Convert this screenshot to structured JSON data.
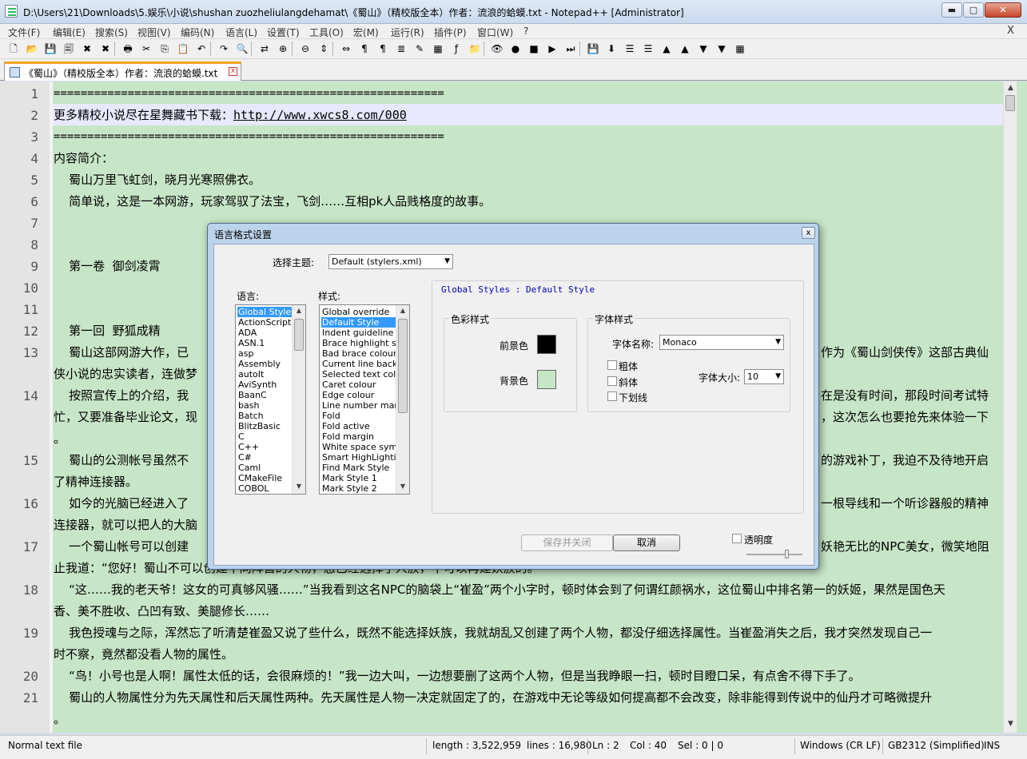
{
  "window": {
    "title": "D:\\Users\\21\\Downloads\\5.娱乐\\小说\\shushan zuozheliulangdehamat\\《蜀山》（精校版全本）作者：流浪的蛤蟆.txt - Notepad++ [Administrator]",
    "min_label": "▬",
    "max_label": "▢",
    "close_label": "✕"
  },
  "menu": {
    "items": [
      "文件(F)",
      "编辑(E)",
      "搜索(S)",
      "视图(V)",
      "编码(N)",
      "语言(L)",
      "设置(T)",
      "工具(O)",
      "宏(M)",
      "运行(R)",
      "插件(P)",
      "窗口(W)",
      "?"
    ],
    "close": "X"
  },
  "toolbar": {
    "icons": [
      "new-file-icon",
      "open-file-icon",
      "save-icon",
      "save-all-icon",
      "close-icon",
      "close-all-icon",
      "print-icon",
      "cut-icon",
      "copy-icon",
      "paste-icon",
      "undo-icon",
      "redo-icon",
      "find-icon",
      "replace-icon",
      "zoom-in-icon",
      "zoom-out-icon",
      "sync-vertical-icon",
      "sync-horizontal-icon",
      "word-wrap-icon",
      "show-all-chars-icon",
      "indent-guide-icon",
      "user-language-icon",
      "doc-map-icon",
      "function-list-icon",
      "folder-workspace-icon",
      "monitor-icon",
      "record-macro-icon",
      "stop-record-icon",
      "play-macro-icon",
      "run-macro-multiple-icon",
      "save-macro-icon",
      "bookmark-icon",
      "list-1-icon",
      "list-2-icon",
      "arrow-up-icon",
      "arrow-up-2-icon",
      "arrow-down-icon",
      "arrow-down-2-icon",
      "table-icon"
    ],
    "glyphs": [
      "🗋",
      "📂",
      "💾",
      "🗐",
      "✖",
      "✖",
      "🖶",
      "✂",
      "⎘",
      "📋",
      "↶",
      "↷",
      "🔍",
      "⇄",
      "⊕",
      "⊖",
      "⇕",
      "⇔",
      "¶",
      "¶",
      "≣",
      "✎",
      "▦",
      "ƒ",
      "📁",
      "👁",
      "●",
      "■",
      "▶",
      "⏭",
      "💾",
      "⬇",
      "☰",
      "☰",
      "▲",
      "▲",
      "▼",
      "▼",
      "▦"
    ]
  },
  "tab": {
    "label": "《蜀山》（精校版全本）作者：流浪的蛤蟆.txt",
    "close_glyph": "x"
  },
  "editor": {
    "line_numbers": [
      "1",
      "2",
      "3",
      "4",
      "5",
      "6",
      "7",
      "8",
      "9",
      "10",
      "11",
      "12",
      "13",
      "14",
      "15",
      "16",
      "17",
      "18",
      "19",
      "20",
      "21"
    ],
    "lines": {
      "l1": "==========================================================",
      "l2_prefix": "更多精校小说尽在星舞藏书下载：",
      "l2_url": "http://www.xwcs8.com/000",
      "l3": "==========================================================",
      "l4": "内容简介：",
      "l5": "    蜀山万里飞虹剑，晓月光寒照佛衣。",
      "l6": "    简单说，这是一本网游，玩家驾驭了法宝，飞剑……互相pk人品贱格度的故事。",
      "l9": "    第一卷  御剑凌霄",
      "l12": "    第一回  野狐成精",
      "l13a": "    蜀山这部网游大作，已",
      "l13b": "作为《蜀山剑侠传》这部古典仙",
      "l13c": "侠小说的忠实读者，连做梦",
      "l14a": "    按照宣传上的介绍，我",
      "l14b": "在是没有时间，那段时间考试特",
      "l14c": "忙，又要准备毕业论文，现",
      "l14d": "，这次怎么也要抢先来体验一下",
      "l14e": "。",
      "l15a": "    蜀山的公测帐号虽然不",
      "l15b": "的游戏补丁，我迫不及待地开启",
      "l15c": "了精神连接器。",
      "l16a": "    如今的光脑已经进入了",
      "l16b": "一根导线和一个听诊器般的精神",
      "l16c": "连接器，就可以把人的大脑",
      "l17a": "    一个蜀山帐号可以创建",
      "l17b": "妖艳无比的NPC美女，微笑地阻",
      "l17c": "止我道：“您好！蜀山不可以创建不同阵营的人物，您已经选择了人族，不可以再建妖族的。",
      "l18a": "    “这……我的老天爷！这女的可真够风骚……”当我看到这名NPC的脑袋上“崔盈”两个小字时，顿时体会到了何谓红颜祸水，这位蜀山中排名第一的妖姬，果然是国色天",
      "l18b": "香、美不胜收、凸凹有致、美腿修长……",
      "l19a": "    我色授魂与之际，浑然忘了听清楚崔盈又说了些什么，既然不能选择妖族，我就胡乱又创建了两个人物，都没仔细选择属性。当崔盈消失之后，我才突然发现自己一",
      "l19b": "时不察，竟然都没看人物的属性。",
      "l20": "    “鸟！小号也是人啊！属性太低的话，会很麻烦的！”我一边大叫，一边想要删了这两个人物，但是当我睁眼一扫，顿时目瞪口呆，有点舍不得下手了。",
      "l21a": "    蜀山的人物属性分为先天属性和后天属性两种。先天属性是人物一决定就固定了的，在游戏中无论等级如何提高都不会改变，除非能得到传说中的仙丹才可略微提升",
      "l21b": "。"
    }
  },
  "status": {
    "file_type": "Normal text file",
    "length": "length : 3,522,959",
    "lines": "lines : 16,980",
    "ln": "Ln : 2",
    "col": "Col : 40",
    "sel": "Sel : 0 | 0",
    "eol": "Windows (CR LF)",
    "encoding": "GB2312 (Simplified)",
    "mode": "INS"
  },
  "dialog": {
    "title": "语言格式设置",
    "close": "x",
    "theme_label": "选择主题:",
    "theme_value": "Default (stylers.xml)",
    "language_label": "语言:",
    "style_label": "样式:",
    "languages": [
      "Global Styles",
      "ActionScript",
      "ADA",
      "ASN.1",
      "asp",
      "Assembly",
      "autoIt",
      "AviSynth",
      "BaanC",
      "bash",
      "Batch",
      "BlitzBasic",
      "C",
      "C++",
      "C#",
      "Caml",
      "CMakeFile",
      "COBOL"
    ],
    "styles": [
      "Global override",
      "Default Style",
      "Indent guideline sty",
      "Brace highlight style",
      "Bad brace colour",
      "Current line backgr",
      "Selected text colou",
      "Caret colour",
      "Edge colour",
      "Line number margin",
      "Fold",
      "Fold active",
      "Fold margin",
      "White space symbo",
      "Smart HighLighting",
      "Find Mark Style",
      "Mark Style 1",
      "Mark Style 2"
    ],
    "header_left": "Global Styles",
    "header_sep": ":",
    "header_right": "Default Style",
    "color_group": "色彩样式",
    "fg_label": "前景色",
    "bg_label": "背景色",
    "fg_color": "#000000",
    "bg_color": "#c7e6c7",
    "font_group": "字体样式",
    "font_name_label": "字体名称:",
    "font_name_value": "Monaco",
    "bold_label": "粗体",
    "italic_label": "斜体",
    "underline_label": "下划线",
    "font_size_label": "字体大小:",
    "font_size_value": "10",
    "save_close": "保存并关闭",
    "cancel": "取消",
    "transparency": "透明度"
  }
}
